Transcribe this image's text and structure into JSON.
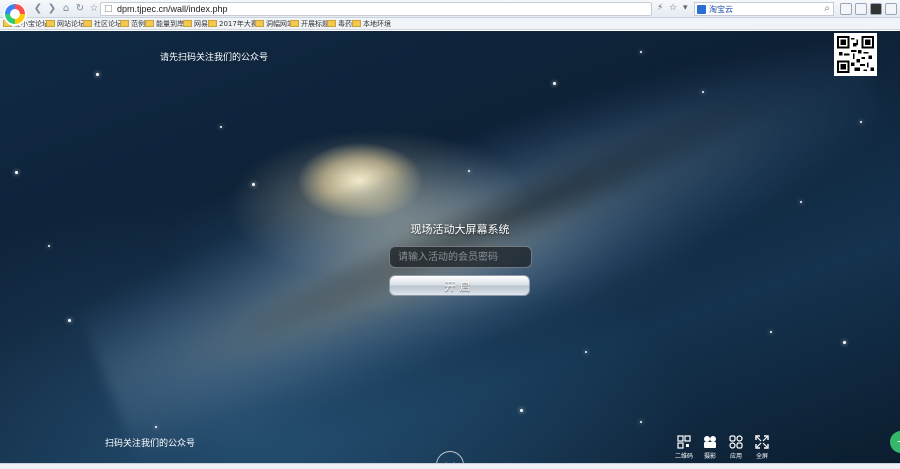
{
  "browser": {
    "url": "dpm.tjpec.cn/wall/index.php",
    "search_engine": "淘宝云",
    "bookmarks": [
      "爱小宝论坛",
      "网站论坛",
      "社区论坛",
      "范例",
      "能量到岸",
      "网易",
      "2017年大赛",
      "洞幅网站",
      "开展标题",
      "毒药",
      "本地环境"
    ]
  },
  "page": {
    "qr_top_label": "请先扫码关注我们的公众号",
    "qr_bottom_label": "扫码关注我们的公众号",
    "system_title": "现场活动大屏幕系统",
    "code_input": {
      "placeholder": "请输入活动的会员密码",
      "value": ""
    },
    "open_button": "开启",
    "toolbar": [
      {
        "label": "二维码",
        "icon": "qr-code-icon"
      },
      {
        "label": "摄影",
        "icon": "camera-icon"
      },
      {
        "label": "应用",
        "icon": "apps-icon"
      },
      {
        "label": "全屏",
        "icon": "fullscreen-icon"
      }
    ]
  }
}
